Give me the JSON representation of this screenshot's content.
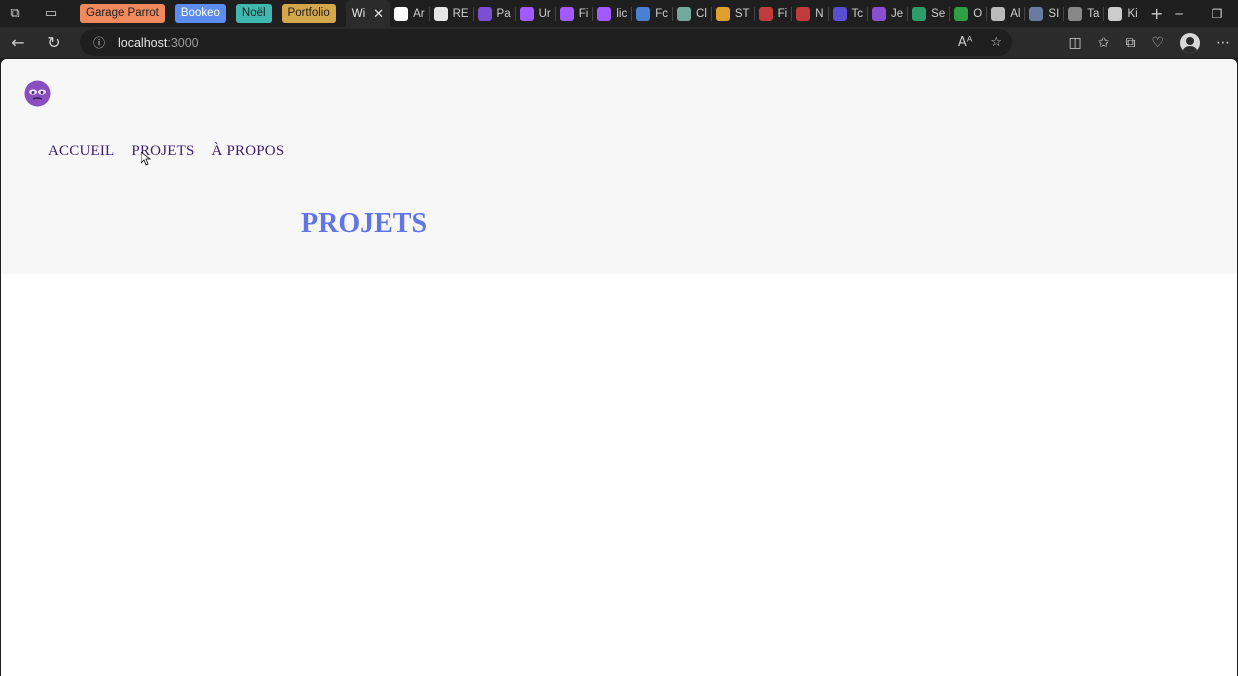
{
  "browser": {
    "tab_groups": [
      {
        "label": "Garage Parrot",
        "color": "#f08a5d",
        "text_color": "#1f1f1f"
      },
      {
        "label": "Bookeo",
        "color": "#5b8def",
        "text_color": "#ffffff"
      },
      {
        "label": "Noël",
        "color": "#3fb8b0",
        "text_color": "#1f1f1f"
      },
      {
        "label": "Portfolio",
        "color": "#d4a84a",
        "text_color": "#1f1f1f"
      }
    ],
    "active_tab_label": "Wi",
    "tabs": [
      {
        "label": "Ar",
        "icon": "figma-icon",
        "color": "#ffffff"
      },
      {
        "label": "RE",
        "icon": "github-icon",
        "color": "#e6e6e6"
      },
      {
        "label": "Pa",
        "icon": "app-icon",
        "color": "#7b4fd1"
      },
      {
        "label": "Ur",
        "icon": "figma-icon",
        "color": "#a259ff"
      },
      {
        "label": "Fi",
        "icon": "figma-icon",
        "color": "#a259ff"
      },
      {
        "label": "lic",
        "icon": "figma-icon",
        "color": "#a259ff"
      },
      {
        "label": "Fc",
        "icon": "board-icon",
        "color": "#4a7fd1"
      },
      {
        "label": "Cl",
        "icon": "chatgpt-icon",
        "color": "#74aa9c"
      },
      {
        "label": "ST",
        "icon": "paper-plane-icon",
        "color": "#e0a030"
      },
      {
        "label": "Fi",
        "icon": "filezilla-icon",
        "color": "#c23b3b"
      },
      {
        "label": "N",
        "icon": "filezilla-icon",
        "color": "#c23b3b"
      },
      {
        "label": "Tc",
        "icon": "app-icon",
        "color": "#5a4fd1"
      },
      {
        "label": "Je",
        "icon": "app-icon",
        "color": "#8a4fd1"
      },
      {
        "label": "Se",
        "icon": "plus-icon",
        "color": "#2e9c6a"
      },
      {
        "label": "O",
        "icon": "square-icon",
        "color": "#2ea043"
      },
      {
        "label": "Al",
        "icon": "app-icon",
        "color": "#bbbbbb"
      },
      {
        "label": "SI",
        "icon": "globe-icon",
        "color": "#6a7aa0"
      },
      {
        "label": "Ta",
        "icon": "dots-icon",
        "color": "#888888"
      },
      {
        "label": "Ki",
        "icon": "cube-icon",
        "color": "#cccccc"
      }
    ],
    "url_host": "localhost",
    "url_port": ":3000"
  },
  "page": {
    "nav": [
      {
        "label": "ACCUEIL"
      },
      {
        "label": "PROJETS"
      },
      {
        "label": "À PROPOS"
      }
    ],
    "title": "PROJETS",
    "title_color": "#6175e6",
    "nav_color": "#3d1d6b"
  }
}
